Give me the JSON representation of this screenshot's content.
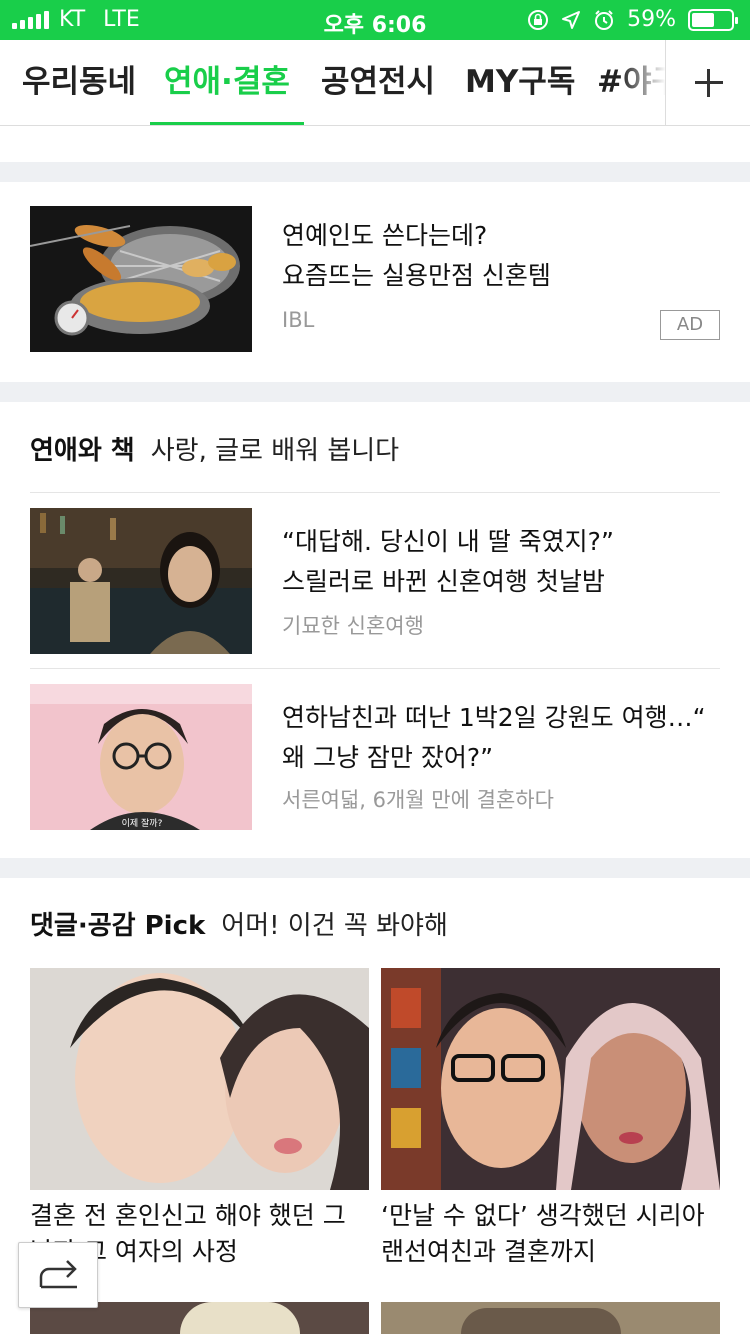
{
  "status_bar": {
    "carrier": "KT",
    "network": "LTE",
    "time": "오후 6:06",
    "battery": "59%",
    "battery_level": 0.59
  },
  "tabs": [
    {
      "label": "우리동네",
      "active": false
    },
    {
      "label": "연애·결혼",
      "active": true
    },
    {
      "label": "공연전시",
      "active": false
    },
    {
      "label": "MY구독",
      "active": false
    },
    {
      "label": "#야구",
      "active": false
    }
  ],
  "ad": {
    "title_line1": "연예인도 쓴다는데?",
    "title_line2": "요즘뜨는 실용만점 신혼템",
    "source": "IBL",
    "badge": "AD"
  },
  "section_love_books": {
    "title": "연애와 책",
    "subtitle": "사랑, 글로 배워 봅니다",
    "articles": [
      {
        "title_line1": "“대답해. 당신이 내 딸 죽였지?”",
        "title_line2": "스릴러로 바뀐 신혼여행 첫날밤",
        "source": "기묘한 신혼여행"
      },
      {
        "title_line1": "연하남친과 떠난 1박2일 강원도 여행…“",
        "title_line2": "왜 그냥 잠만 잤어?”",
        "source": "서른여덟, 6개월 만에 결혼하다",
        "caption": "이제 잘까?"
      }
    ]
  },
  "section_pick": {
    "title": "댓글·공감 Pick",
    "subtitle": "어머! 이건 꼭 봐야해",
    "cards": [
      {
        "title_line1": "결혼 전 혼인신고 해야 했던 그",
        "title_line2": "남자 그 여자의 사정"
      },
      {
        "title_line1": "‘만날 수 없다’ 생각했던 시리아",
        "title_line2": "랜선여친과 결혼까지"
      }
    ]
  },
  "icons": {
    "add_tab": "plus-icon",
    "share": "share-arrow-icon",
    "status": [
      "signal-icon",
      "lock-rotation-icon",
      "location-arrow-icon",
      "alarm-icon",
      "battery-icon"
    ]
  },
  "colors": {
    "accent": "#19ce4a",
    "gap": "#eef0f3",
    "muted": "#999999"
  }
}
